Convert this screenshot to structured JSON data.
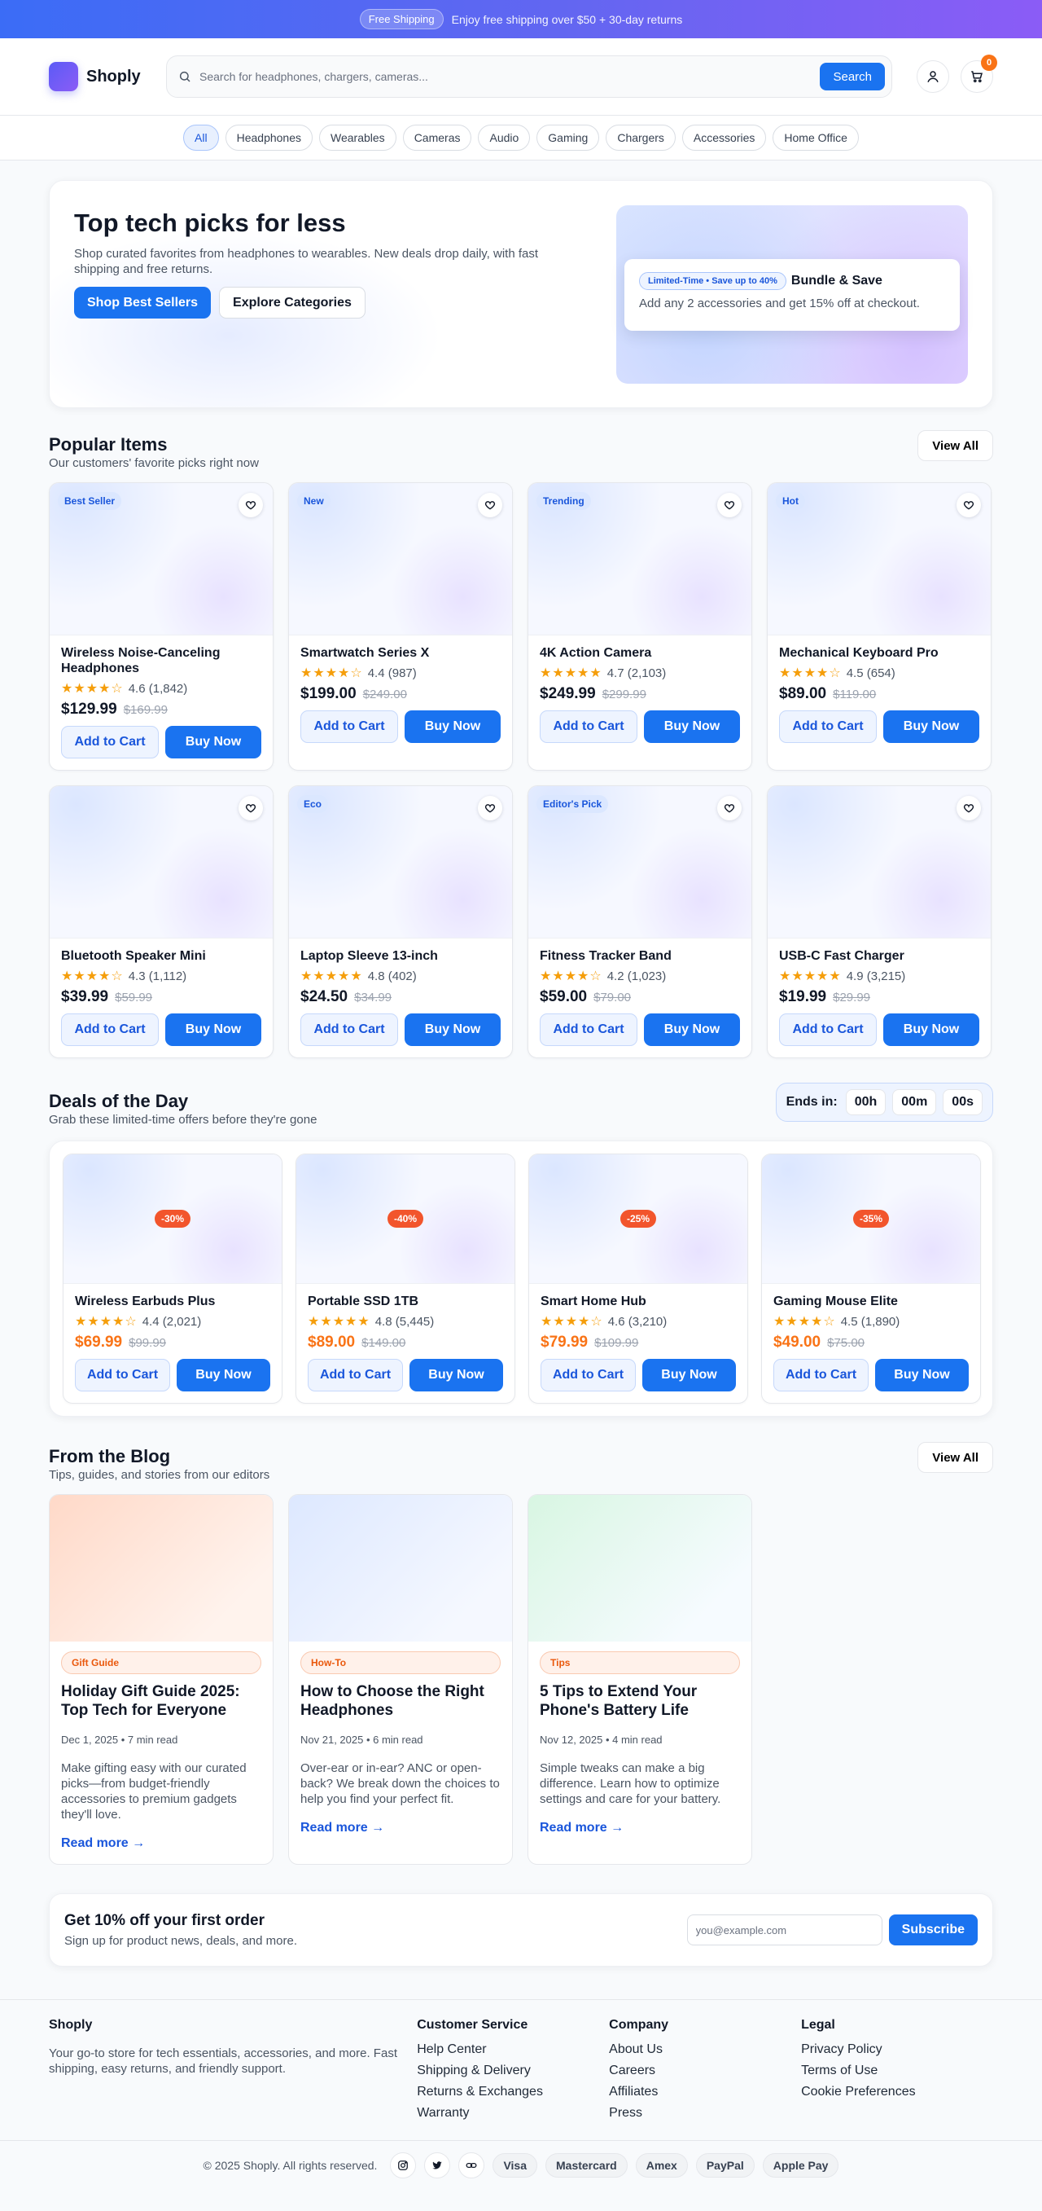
{
  "colors": {
    "primary": "#1a73f0",
    "accent": "#f97316",
    "star": "#f59e0b",
    "deal_tag": "#f2552c"
  },
  "topbar": {
    "pill": "Free Shipping",
    "message": "Enjoy free shipping over $50 + 30-day returns"
  },
  "header": {
    "logo_text": "Shoply",
    "search_placeholder": "Search for headphones, chargers, cameras...",
    "search_button": "Search",
    "cart_count": "0"
  },
  "categories": [
    "All",
    "Headphones",
    "Wearables",
    "Cameras",
    "Audio",
    "Gaming",
    "Chargers",
    "Accessories",
    "Home Office"
  ],
  "hero": {
    "title": "Top tech picks for less",
    "subtitle": "Shop curated favorites from headphones to wearables. New deals drop daily, with fast shipping and free returns.",
    "primary_button": "Shop Best Sellers",
    "secondary_button": "Explore Categories",
    "promo_tag": "Limited-Time • Save up to 40%",
    "promo_title": "Bundle & Save",
    "promo_text": "Add any 2 accessories and get 15% off at checkout."
  },
  "popular": {
    "title": "Popular Items",
    "subtitle": "Our customers' favorite picks right now",
    "view_all": "View All",
    "add_label": "Add to Cart",
    "buy_label": "Buy Now",
    "items": [
      {
        "tag": "Best Seller",
        "name": "Wireless Noise-Canceling Headphones",
        "stars": "★★★★☆",
        "rating": "4.6 (1,842)",
        "price": "$129.99",
        "old": "$169.99"
      },
      {
        "tag": "New",
        "name": "Smartwatch Series X",
        "stars": "★★★★☆",
        "rating": "4.4 (987)",
        "price": "$199.00",
        "old": "$249.00"
      },
      {
        "tag": "Trending",
        "name": "4K Action Camera",
        "stars": "★★★★★",
        "rating": "4.7 (2,103)",
        "price": "$249.99",
        "old": "$299.99"
      },
      {
        "tag": "Hot",
        "name": "Mechanical Keyboard Pro",
        "stars": "★★★★☆",
        "rating": "4.5 (654)",
        "price": "$89.00",
        "old": "$119.00"
      },
      {
        "tag": "",
        "name": "Bluetooth Speaker Mini",
        "stars": "★★★★☆",
        "rating": "4.3 (1,112)",
        "price": "$39.99",
        "old": "$59.99"
      },
      {
        "tag": "Eco",
        "name": "Laptop Sleeve 13-inch",
        "stars": "★★★★★",
        "rating": "4.8 (402)",
        "price": "$24.50",
        "old": "$34.99"
      },
      {
        "tag": "Editor's Pick",
        "name": "Fitness Tracker Band",
        "stars": "★★★★☆",
        "rating": "4.2 (1,023)",
        "price": "$59.00",
        "old": "$79.00"
      },
      {
        "tag": "",
        "name": "USB-C Fast Charger",
        "stars": "★★★★★",
        "rating": "4.9 (3,215)",
        "price": "$19.99",
        "old": "$29.99"
      }
    ]
  },
  "deals": {
    "title": "Deals of the Day",
    "subtitle": "Grab these limited-time offers before they're gone",
    "ends_label": "Ends in:",
    "hours": "00h",
    "minutes": "00m",
    "seconds": "00s",
    "items": [
      {
        "discount": "-30%",
        "name": "Wireless Earbuds Plus",
        "stars": "★★★★☆",
        "rating": "4.4 (2,021)",
        "price": "$69.99",
        "old": "$99.99"
      },
      {
        "discount": "-40%",
        "name": "Portable SSD 1TB",
        "stars": "★★★★★",
        "rating": "4.8 (5,445)",
        "price": "$89.00",
        "old": "$149.00"
      },
      {
        "discount": "-25%",
        "name": "Smart Home Hub",
        "stars": "★★★★☆",
        "rating": "4.6 (3,210)",
        "price": "$79.99",
        "old": "$109.99"
      },
      {
        "discount": "-35%",
        "name": "Gaming Mouse Elite",
        "stars": "★★★★☆",
        "rating": "4.5 (1,890)",
        "price": "$49.00",
        "old": "$75.00"
      }
    ]
  },
  "blog": {
    "title": "From the Blog",
    "subtitle": "Tips, guides, and stories from our editors",
    "view_all": "View All",
    "read_more": "Read more →",
    "posts": [
      {
        "tag": "Gift Guide",
        "title": "Holiday Gift Guide 2025: Top Tech for Everyone",
        "meta": "Dec 1, 2025 • 7 min read",
        "excerpt": "Make gifting easy with our curated picks—from budget-friendly accessories to premium gadgets they'll love."
      },
      {
        "tag": "How-To",
        "title": "How to Choose the Right Headphones",
        "meta": "Nov 21, 2025 • 6 min read",
        "excerpt": "Over-ear or in-ear? ANC or open-back? We break down the choices to help you find your perfect fit."
      },
      {
        "tag": "Tips",
        "title": "5 Tips to Extend Your Phone's Battery Life",
        "meta": "Nov 12, 2025 • 4 min read",
        "excerpt": "Simple tweaks can make a big difference. Learn how to optimize settings and care for your battery."
      }
    ]
  },
  "newsletter": {
    "title": "Get 10% off your first order",
    "subtitle": "Sign up for product news, deals, and more.",
    "placeholder": "you@example.com",
    "button": "Subscribe"
  },
  "footer": {
    "brand": "Shoply",
    "description": "Your go-to store for tech essentials, accessories, and more. Fast shipping, easy returns, and friendly support.",
    "columns": [
      {
        "title": "Customer Service",
        "links": [
          "Help Center",
          "Shipping & Delivery",
          "Returns & Exchanges",
          "Warranty"
        ]
      },
      {
        "title": "Company",
        "links": [
          "About Us",
          "Careers",
          "Affiliates",
          "Press"
        ]
      },
      {
        "title": "Legal",
        "links": [
          "Privacy Policy",
          "Terms of Use",
          "Cookie Preferences"
        ]
      }
    ],
    "copyright": "© 2025 Shoply. All rights reserved.",
    "social_icons": [
      "instagram-icon",
      "twitter-icon",
      "link-icon"
    ],
    "payments": [
      "Visa",
      "Mastercard",
      "Amex",
      "PayPal",
      "Apple Pay"
    ]
  }
}
